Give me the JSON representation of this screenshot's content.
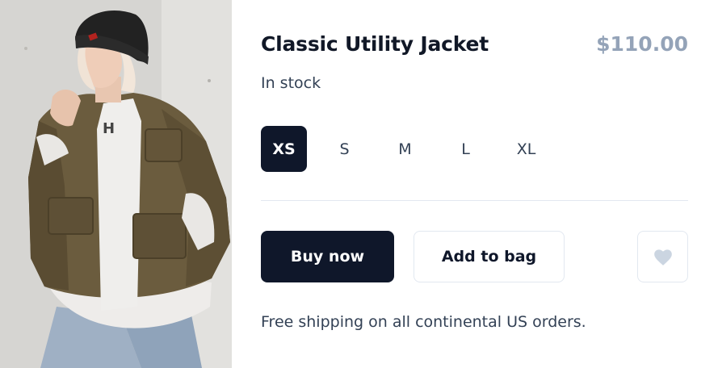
{
  "product": {
    "title": "Classic Utility Jacket",
    "price": "$110.00",
    "stock_status": "In stock",
    "image_alt": "person wearing olive utility jacket and black beanie"
  },
  "sizes": {
    "options": [
      "XS",
      "S",
      "M",
      "L",
      "XL"
    ],
    "selected": "XS"
  },
  "actions": {
    "buy_label": "Buy now",
    "bag_label": "Add to bag",
    "favorite_icon": "heart-icon"
  },
  "footer": {
    "shipping_note": "Free shipping on all continental US orders."
  },
  "colors": {
    "primary": "#0f172a",
    "price": "#94a3b8",
    "text": "#334155",
    "border": "#e2e8f0",
    "heart": "#cbd5e1"
  }
}
